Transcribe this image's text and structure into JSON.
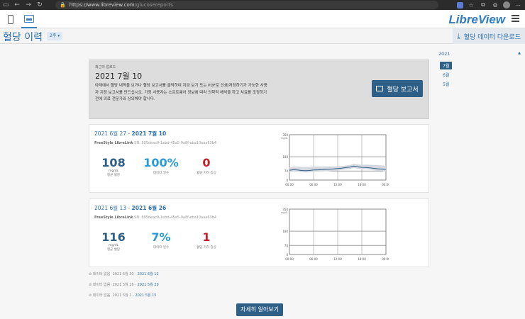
{
  "browser": {
    "url_host": "https://www.libreview.com",
    "url_path": "/glucosereports"
  },
  "header": {
    "logo": "LibreView"
  },
  "titlebar": {
    "title": "혈당 이력",
    "period_select": "2주",
    "download_label": "혈당 데이터 다운로드"
  },
  "recent": {
    "kicker": "최근의 업로드",
    "date": "2021 7월 10",
    "desc": "아래에서 혈당 내역을 보거나 혈당 보고서를 클릭하여 지금 보기 또는 PDF로 인쇄/저장하기가 가능한 사용자 지정 보고서를 만드십시오. 가정 사용자는 소프트웨어 정보에 따라 의학적 해석을 하고 치료를 조정하기 전에 의료 전문가와 상의해야 합니다.",
    "button_label": "혈당 보고서"
  },
  "cards": [
    {
      "range_start": "2021 6월 27 - ",
      "range_end": "2021 7월 10",
      "device_name": "FreeStyle LibreLink",
      "device_sn": " SN: 505deac0-1ebd-45a5-9a8f-eba10aaa63b4",
      "avg_value": "108",
      "avg_unit": "mg/dL",
      "avg_label": "평균 혈당",
      "data_value": "100",
      "data_suffix": "%",
      "data_label": "데이터 일수",
      "low_value": "0",
      "low_label": "혈당 저하 증상",
      "y_unit": "mg/dL",
      "y_ticks": [
        "350",
        "180",
        "70",
        "0"
      ],
      "x_ticks": [
        "00:00",
        "06:00",
        "12:00",
        "18:00",
        "00:00"
      ],
      "median_curve": [
        [
          0,
          76
        ],
        [
          1,
          80
        ],
        [
          2,
          78
        ],
        [
          3,
          74
        ],
        [
          4,
          73
        ],
        [
          5,
          74
        ],
        [
          6,
          78
        ],
        [
          7,
          79
        ],
        [
          8,
          80
        ],
        [
          9,
          82
        ],
        [
          10,
          84
        ],
        [
          11,
          86
        ],
        [
          12,
          89
        ],
        [
          13,
          92
        ],
        [
          14,
          96
        ],
        [
          15,
          100
        ],
        [
          16,
          108
        ],
        [
          17,
          103
        ],
        [
          18,
          98
        ],
        [
          19,
          97
        ],
        [
          20,
          94
        ],
        [
          21,
          90
        ],
        [
          22,
          87
        ],
        [
          23,
          85
        ],
        [
          24,
          82
        ]
      ]
    },
    {
      "range_start": "2021 6월 13 - ",
      "range_end": "2021 6월 26",
      "device_name": "FreeStyle LibreLink",
      "device_sn": " SN: 505deac0-1ebd-45a5-9a8f-eba10aaa63b4",
      "avg_value": "116",
      "avg_unit": "mg/dL",
      "avg_label": "평균 혈당",
      "data_value": "7",
      "data_suffix": "%",
      "data_label": "데이터 일수",
      "low_value": "1",
      "low_label": "혈당 저하 증상",
      "y_unit": "mg/dL",
      "y_ticks": [
        "350",
        "180",
        "70",
        "0"
      ],
      "x_ticks": [
        "00:00",
        "06:00",
        "12:00",
        "18:00",
        "00:00"
      ]
    }
  ],
  "nodata": [
    {
      "label": "데이터 없음",
      "range_start": "2021 5월 30 - ",
      "range_end": "2021 6월 12"
    },
    {
      "label": "데이터 없음",
      "range_start": "2021 5월 16 - ",
      "range_end": "2021 5월 29"
    },
    {
      "label": "데이터 없음",
      "range_start": "2021 5월 2 - ",
      "range_end": "2021 5월 15"
    }
  ],
  "learn_more": "자세히 알아보기",
  "sidebar": {
    "year": "2021",
    "months": [
      "7월",
      "6월",
      "5월"
    ]
  },
  "colors": {
    "accent": "#2e5f86",
    "link": "#2e6fa8",
    "percent": "#2a9ad8",
    "low": "#c0232c",
    "band": "#d4d8e0"
  }
}
